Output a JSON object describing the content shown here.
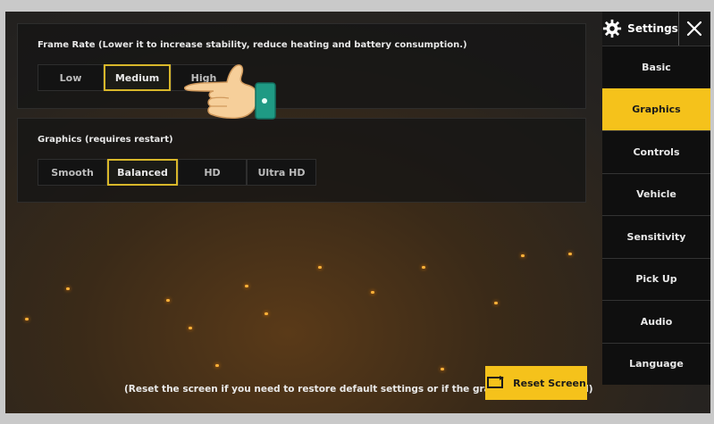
{
  "frame_rate": {
    "title": "Frame Rate (Lower it to increase stability, reduce heating and battery consumption.)",
    "options": [
      "Low",
      "Medium",
      "High"
    ],
    "selected": "Medium"
  },
  "graphics": {
    "title": "Graphics (requires restart)",
    "options": [
      "Smooth",
      "Balanced",
      "HD",
      "Ultra HD"
    ],
    "selected": "Balanced"
  },
  "sidebar": {
    "header": "Settings",
    "close_icon": "close-icon",
    "settings_icon": "gear-icon",
    "items": [
      {
        "label": "Basic"
      },
      {
        "label": "Graphics"
      },
      {
        "label": "Controls"
      },
      {
        "label": "Vehicle"
      },
      {
        "label": "Sensitivity"
      },
      {
        "label": "Pick Up"
      },
      {
        "label": "Audio"
      },
      {
        "label": "Language"
      }
    ],
    "active": "Graphics"
  },
  "footer": {
    "hint": "(Reset the screen if you need to restore default settings or if the graphics are not ideal)",
    "reset_label": "Reset Screen"
  },
  "colors": {
    "accent": "#f5c21b",
    "selected_border": "#d8b72a"
  }
}
